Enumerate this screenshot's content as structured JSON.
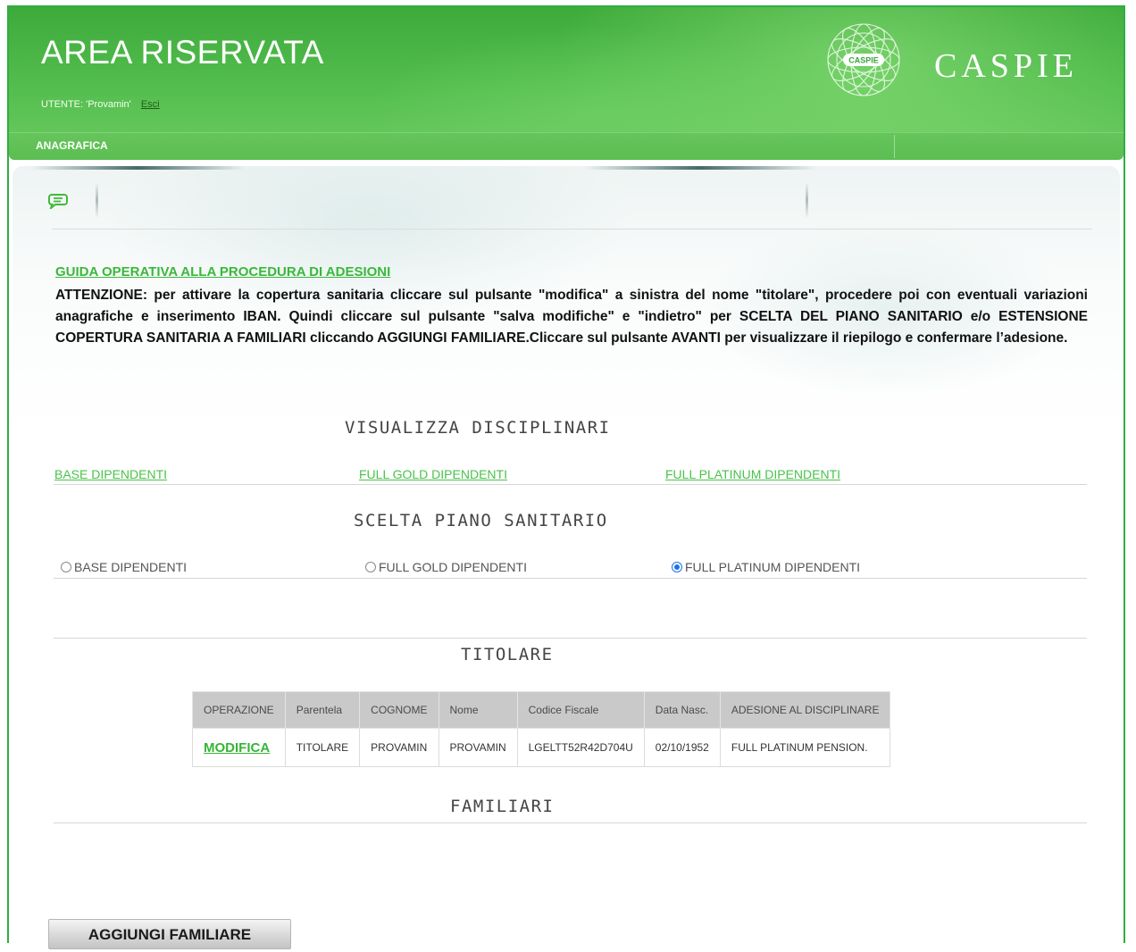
{
  "header": {
    "title": "AREA RISERVATA",
    "user_label": "UTENTE: 'Provamin'",
    "logout_label": "Esci",
    "logo_text": "CASPIE",
    "brand": "CASPIE"
  },
  "menu": {
    "items": [
      {
        "label": "ANAGRAFICA"
      }
    ]
  },
  "content": {
    "guide_link": "GUIDA OPERATIVA ALLA PROCEDURA DI ADESIONI",
    "attention": "ATTENZIONE: per attivare la copertura sanitaria cliccare sul pulsante \"modifica\" a sinistra del nome \"titolare\", procedere poi con eventuali variazioni anagrafiche e inserimento IBAN. Quindi cliccare sul pulsante \"salva modifiche\" e \"indietro\" per SCELTA DEL PIANO SANITARIO e/o ESTENSIONE COPERTURA SANITARIA A FAMILIARI cliccando AGGIUNGI FAMILIARE.Cliccare sul pulsante AVANTI per visualizzare il riepilogo e confermare l’adesione.",
    "disciplinari_title": "VISUALIZZA DISCIPLINARI",
    "disciplinari_links": [
      "BASE DIPENDENTI",
      "FULL GOLD DIPENDENTI",
      "FULL PLATINUM DIPENDENTI"
    ],
    "piano_title": "SCELTA PIANO SANITARIO",
    "piano_options": [
      {
        "label": "BASE DIPENDENTI",
        "checked": false
      },
      {
        "label": "FULL GOLD DIPENDENTI",
        "checked": false
      },
      {
        "label": "FULL PLATINUM DIPENDENTI",
        "checked": true
      }
    ],
    "titolare_title": "TITOLARE",
    "table": {
      "headers": [
        "OPERAZIONE",
        "Parentela",
        "COGNOME",
        "Nome",
        "Codice Fiscale",
        "Data Nasc.",
        "ADESIONE AL DISCIPLINARE"
      ],
      "rows": [
        [
          "MODIFICA",
          "TITOLARE",
          "PROVAMIN",
          "PROVAMIN",
          "LGELTT52R42D704U",
          "02/10/1952",
          "FULL PLATINUM PENSION."
        ]
      ]
    },
    "familiari_title": "FAMILIARI",
    "add_button": "AGGIUNGI FAMILIARE"
  },
  "colors": {
    "brand_green": "#50bb4b",
    "link_green": "#39b83a",
    "radio_selected": "#1a73e8"
  },
  "icons": {
    "chat": "chat-bubble-icon",
    "logo": "caspie-globe-logo"
  }
}
